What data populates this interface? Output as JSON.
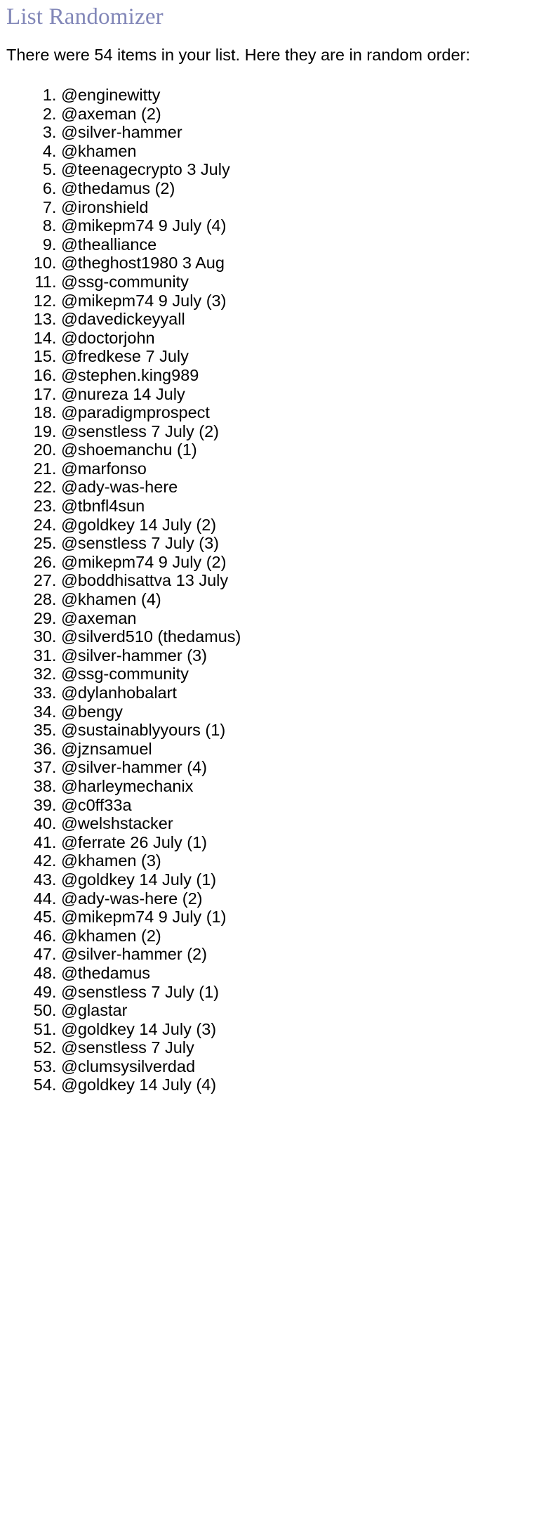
{
  "page": {
    "title": "List Randomizer",
    "title_color": "#8287b8",
    "background_color": "#ffffff",
    "text_color": "#000000"
  },
  "intro": {
    "text": "There were 54 items in your list. Here they are in random order:",
    "item_count": 54
  },
  "results": {
    "items": [
      "@enginewitty",
      "@axeman (2)",
      "@silver-hammer",
      "@khamen",
      "@teenagecrypto 3 July",
      "@thedamus (2)",
      "@ironshield",
      "@mikepm74 9 July (4)",
      "@thealliance",
      "@theghost1980 3 Aug",
      "@ssg-community",
      "@mikepm74 9 July (3)",
      "@davedickeyyall",
      "@doctorjohn",
      "@fredkese 7 July",
      "@stephen.king989",
      "@nureza 14 July",
      "@paradigmprospect",
      "@senstless 7 July (2)",
      "@shoemanchu (1)",
      "@marfonso",
      "@ady-was-here",
      "@tbnfl4sun",
      "@goldkey 14 July (2)",
      "@senstless 7 July (3)",
      "@mikepm74 9 July (2)",
      "@boddhisattva 13 July",
      "@khamen (4)",
      "@axeman",
      "@silverd510 (thedamus)",
      "@silver-hammer (3)",
      "@ssg-community",
      "@dylanhobalart",
      "@bengy",
      "@sustainablyyours (1)",
      "@jznsamuel",
      "@silver-hammer (4)",
      "@harleymechanix",
      "@c0ff33a",
      "@welshstacker",
      "@ferrate 26 July (1)",
      "@khamen (3)",
      "@goldkey 14 July (1)",
      "@ady-was-here (2)",
      "@mikepm74 9 July (1)",
      "@khamen (2)",
      "@silver-hammer (2)",
      "@thedamus",
      "@senstless 7 July (1)",
      "@glastar",
      "@goldkey 14 July (3)",
      "@senstless 7 July",
      "@clumsysilverdad",
      "@goldkey 14 July (4)"
    ]
  }
}
